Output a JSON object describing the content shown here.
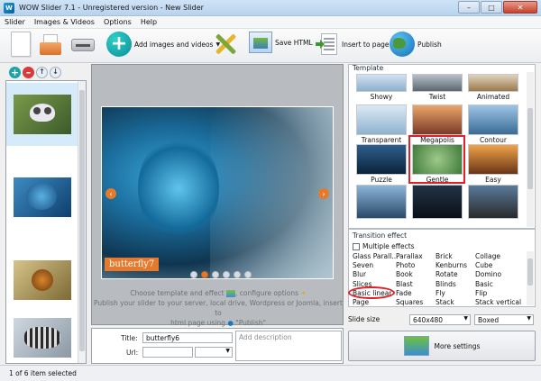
{
  "window": {
    "title": "WOW Slider 7.1 - Unregistered version - New Slider",
    "minimize": "–",
    "maximize": "□",
    "close": "✕"
  },
  "menu": [
    "Slider",
    "Images & Videos",
    "Options",
    "Help"
  ],
  "toolbar": {
    "add_label": "Add images and videos",
    "save_html_label": "Save HTML",
    "insert_label": "Insert to page",
    "publish_label": "Publish"
  },
  "colors": {
    "accent_orange": "#e67a2c",
    "highlight_red": "#e01f26"
  },
  "preview": {
    "caption": "butterfly7",
    "dots_count": 6,
    "active_dot": 1,
    "help_line1": "Choose template and effect",
    "help_line1b": ", configure options",
    "help_line2": "Publish your slider to your server, local drive, Wordpress or Joomla, insert to",
    "help_line3": "html page using",
    "help_line3b": "\"Publish\""
  },
  "form": {
    "title_label": "Title:",
    "title_value": "butterfly6",
    "url_label": "Url:",
    "url_value": "",
    "description_placeholder": "Add description"
  },
  "template": {
    "group_title": "Template",
    "items": [
      {
        "name": "Showy"
      },
      {
        "name": "Twist"
      },
      {
        "name": "Animated"
      },
      {
        "name": "Transparent"
      },
      {
        "name": "Megapolis"
      },
      {
        "name": "Contour"
      },
      {
        "name": "Puzzle"
      },
      {
        "name": "Gentle"
      },
      {
        "name": "Easy"
      }
    ],
    "selected": "Gentle"
  },
  "transition": {
    "group_title": "Transition effect",
    "multiple_label": "Multiple effects",
    "multiple_checked": false,
    "columns": [
      [
        "Glass Parall...",
        "Seven",
        "Blur",
        "Slices",
        "Basic linear",
        "Page"
      ],
      [
        "Parallax",
        "Photo",
        "Book",
        "Blast",
        "Fade",
        "Squares"
      ],
      [
        "Brick",
        "Kenburns",
        "Rotate",
        "Blinds",
        "Fly",
        "Stack"
      ],
      [
        "Collage",
        "Cube",
        "Domino",
        "Basic",
        "Flip",
        "Stack vertical"
      ]
    ],
    "selected": "Basic linear"
  },
  "slide_size": {
    "label": "Slide size",
    "size_value": "640x480",
    "mode_value": "Boxed"
  },
  "more_settings": "More settings",
  "status": "1 of 6 item selected"
}
